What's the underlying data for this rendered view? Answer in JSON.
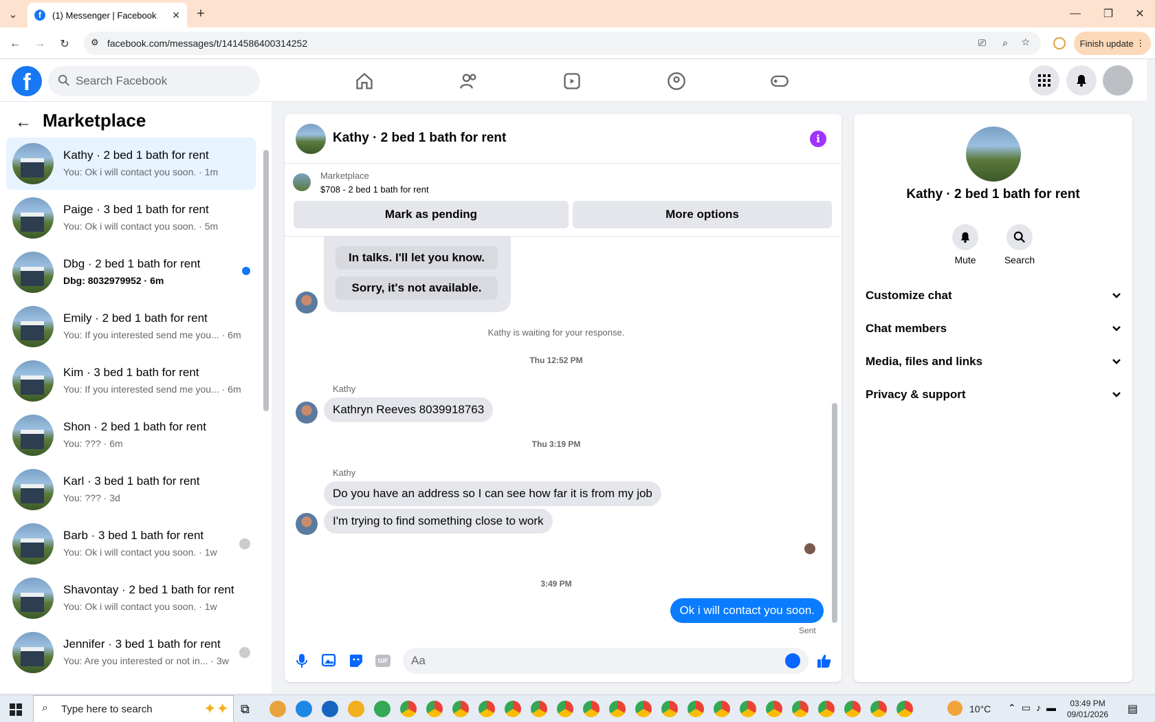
{
  "browser": {
    "tab_title": "(1) Messenger | Facebook",
    "url": "facebook.com/messages/t/1414586400314252",
    "finish_update": "Finish update"
  },
  "header": {
    "search_placeholder": "Search Facebook"
  },
  "sidebar": {
    "title": "Marketplace",
    "conversations": [
      {
        "title": "Kathy · 2 bed 1 bath for rent",
        "snippet": "You: Ok i will contact you soon. · 1m",
        "active": true
      },
      {
        "title": "Paige · 3 bed 1 bath for rent",
        "snippet": "You: Ok i will contact you soon. · 5m"
      },
      {
        "title": "Dbg · 2 bed 1 bath for rent",
        "snippet": "Dbg: 8032979952 · 6m",
        "unread": true
      },
      {
        "title": "Emily · 2 bed 1 bath for rent",
        "snippet": "You: If you interested send me you... · 6m"
      },
      {
        "title": "Kim · 3 bed 1 bath for rent",
        "snippet": "You: If you interested send me you... · 6m"
      },
      {
        "title": "Shon · 2 bed 1 bath for rent",
        "snippet": "You: ??? · 6m"
      },
      {
        "title": "Karl · 3 bed 1 bath for rent",
        "snippet": "You: ??? · 3d"
      },
      {
        "title": "Barb · 3 bed 1 bath for rent",
        "snippet": "You: Ok i will contact you soon. · 1w"
      },
      {
        "title": "Shavontay · 2 bed 1 bath for rent",
        "snippet": "You: Ok i will contact you soon. · 1w"
      },
      {
        "title": "Jennifer · 3 bed 1 bath for rent",
        "snippet": "You: Are you interested or not in... · 3w"
      }
    ]
  },
  "chat": {
    "title": "Kathy · 2 bed 1 bath for rent",
    "marketplace_label": "Marketplace",
    "listing": "$708 - 2 bed 1 bath for rent",
    "mark_pending": "Mark as pending",
    "more_options": "More options",
    "quick_replies": [
      "In talks. I'll let you know.",
      "Sorry, it's not available."
    ],
    "waiting": "Kathy is waiting for your response.",
    "time1": "Thu 12:52 PM",
    "sender1": "Kathy",
    "msg1": "Kathryn Reeves 8039918763",
    "time2": "Thu 3:19 PM",
    "sender2": "Kathy",
    "msg2": "Do you have an address so I can see how far it is from my job",
    "msg3": "I'm trying to find something close to work",
    "time3": "3:49 PM",
    "my_msg": "Ok i will contact you soon.",
    "sent": "Sent",
    "composer_placeholder": "Aa"
  },
  "rpanel": {
    "name": "Kathy · 2 bed 1 bath for rent",
    "mute": "Mute",
    "search": "Search",
    "rows": [
      "Customize chat",
      "Chat members",
      "Media, files and links",
      "Privacy & support"
    ]
  },
  "taskbar": {
    "search_placeholder": "Type here to search",
    "temperature": "10°C",
    "time": "03:49 PM",
    "date": "09/01/2026"
  },
  "colors": {
    "brand": "#1877f2",
    "my_bubble": "#0a7cff",
    "info": "#a033ff"
  }
}
